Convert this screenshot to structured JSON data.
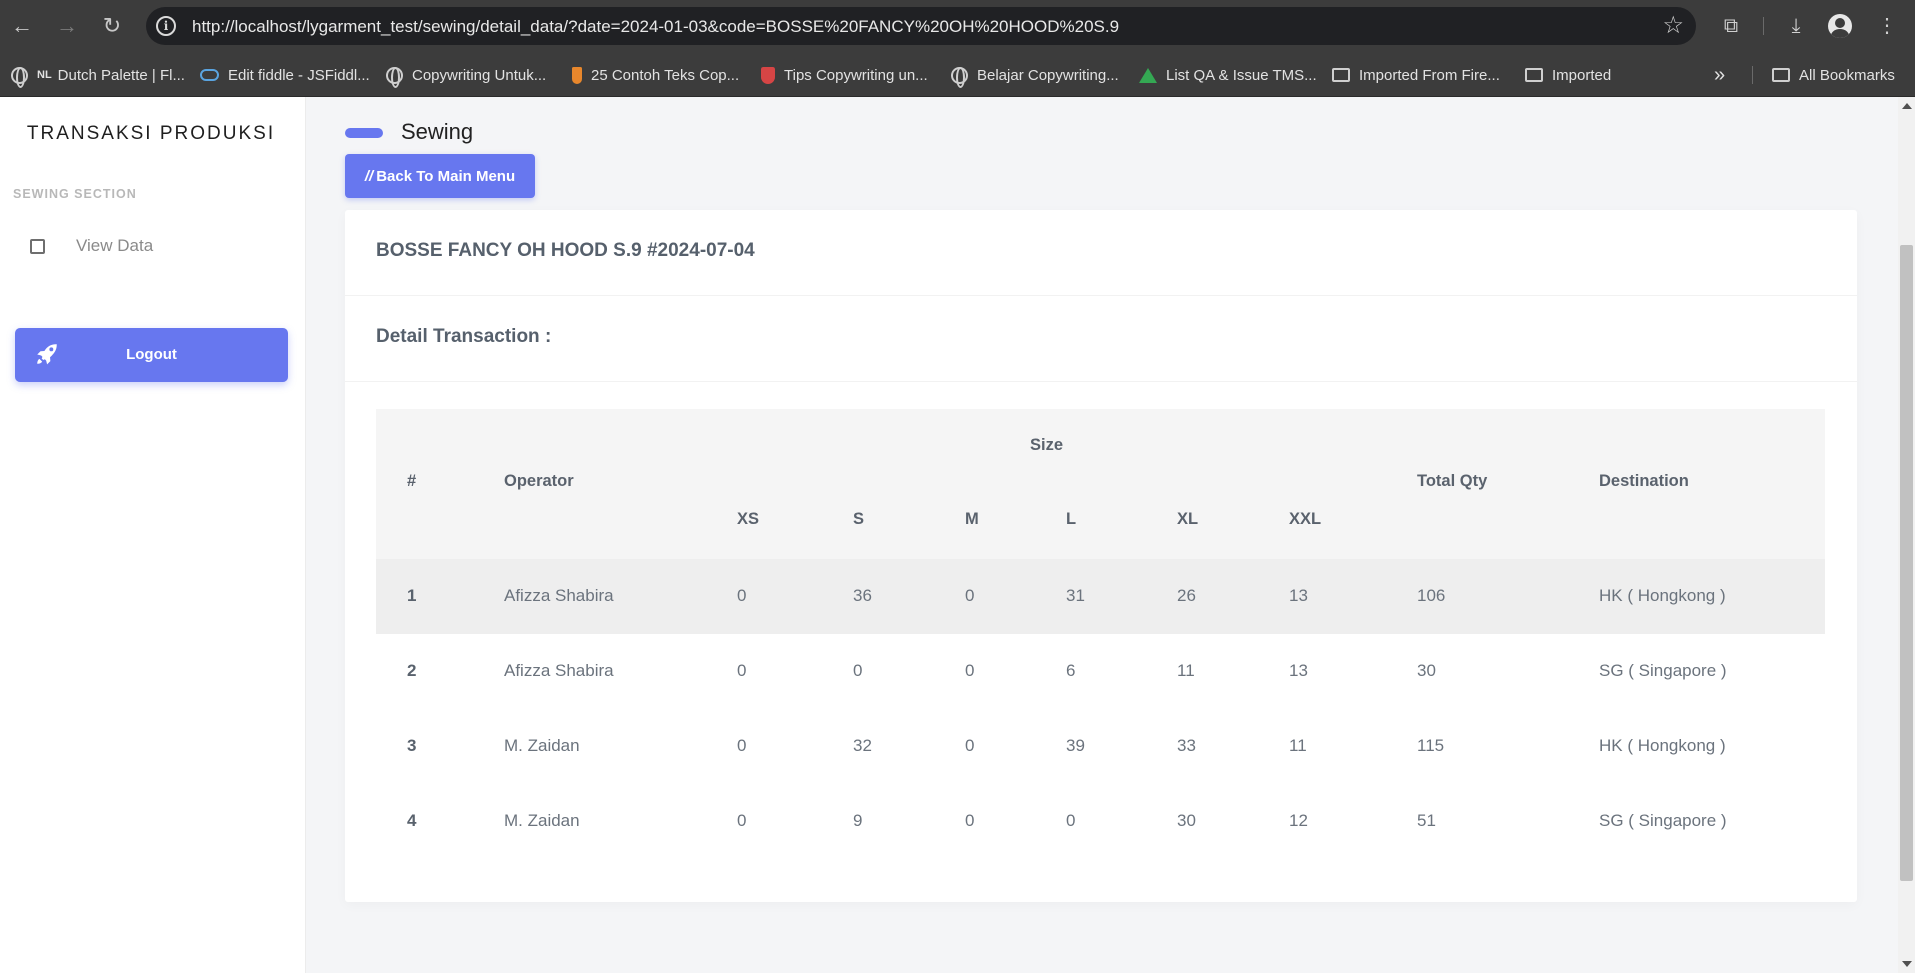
{
  "browser": {
    "url": "http://localhost/lygarment_test/sewing/detail_data/?date=2024-01-03&code=BOSSE%20FANCY%20OH%20HOOD%20S.9",
    "bookmarks": [
      {
        "label": "Dutch Palette | Fl...",
        "prefix": "NL",
        "icon": "globe-icon"
      },
      {
        "label": "Edit fiddle - JSFiddl...",
        "icon": "jsfiddle-icon"
      },
      {
        "label": "Copywriting Untuk...",
        "icon": "globe-icon"
      },
      {
        "label": "25 Contoh Teks Cop...",
        "icon": "torch-icon"
      },
      {
        "label": "Tips Copywriting un...",
        "icon": "shield-icon"
      },
      {
        "label": "Belajar Copywriting...",
        "icon": "globe-icon"
      },
      {
        "label": "List QA & Issue TMS...",
        "icon": "google-drive-icon"
      },
      {
        "label": "Imported From Fire...",
        "icon": "folder-icon"
      },
      {
        "label": "Imported",
        "icon": "folder-icon"
      }
    ],
    "all_bookmarks_label": "All Bookmarks",
    "more_bookmarks": "»"
  },
  "sidebar": {
    "brand": "TRANSAKSI PRODUKSI",
    "section_label": "SEWING SECTION",
    "items": [
      {
        "label": "View Data",
        "icon": "square-icon"
      }
    ],
    "logout_label": "Logout"
  },
  "header": {
    "title": "Sewing",
    "back_label": "Back To Main Menu"
  },
  "card": {
    "title": "BOSSE FANCY OH HOOD S.9 #2024-07-04",
    "subtitle": "Detail Transaction :"
  },
  "table": {
    "headers": {
      "num": "#",
      "operator": "Operator",
      "size": "Size",
      "sizes": [
        "XS",
        "S",
        "M",
        "L",
        "XL",
        "XXL"
      ],
      "total": "Total Qty",
      "destination": "Destination"
    },
    "rows": [
      {
        "num": "1",
        "operator": "Afizza Shabira",
        "sizes": [
          "0",
          "36",
          "0",
          "31",
          "26",
          "13"
        ],
        "total": "106",
        "destination": "HK ( Hongkong )"
      },
      {
        "num": "2",
        "operator": "Afizza Shabira",
        "sizes": [
          "0",
          "0",
          "0",
          "6",
          "11",
          "13"
        ],
        "total": "30",
        "destination": "SG ( Singapore )"
      },
      {
        "num": "3",
        "operator": "M. Zaidan",
        "sizes": [
          "0",
          "32",
          "0",
          "39",
          "33",
          "11"
        ],
        "total": "115",
        "destination": "HK ( Hongkong )"
      },
      {
        "num": "4",
        "operator": "M. Zaidan",
        "sizes": [
          "0",
          "9",
          "0",
          "0",
          "30",
          "12"
        ],
        "total": "51",
        "destination": "SG ( Singapore )"
      }
    ]
  },
  "colors": {
    "accent": "#6777ef",
    "chrome": "#3c3c3c",
    "omnibox": "#202124"
  }
}
